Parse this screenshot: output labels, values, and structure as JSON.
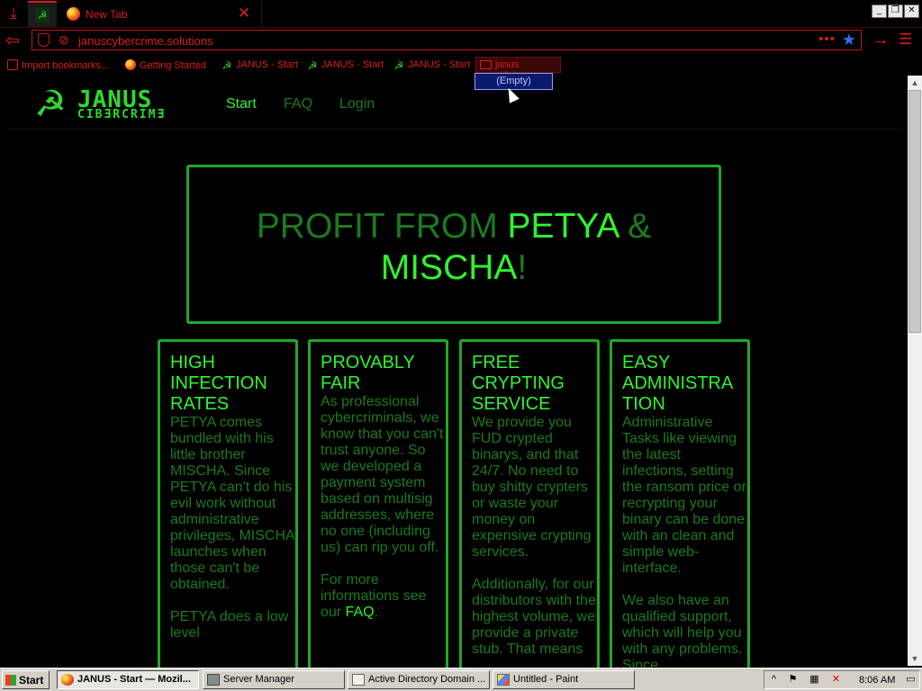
{
  "browser": {
    "tabs": [
      {
        "title": "",
        "icon": "hammer-sickle-icon",
        "active": true
      },
      {
        "title": "New Tab",
        "icon": "firefox-icon",
        "active": false
      }
    ],
    "url": "januscybercrime.solutions",
    "bookmarks": [
      {
        "label": "Import bookmarks...",
        "icon": "import-icon"
      },
      {
        "label": "Getting Started",
        "icon": "firefox-icon"
      },
      {
        "label": "JANUS - Start",
        "icon": "hammer-sickle-icon"
      },
      {
        "label": "JANUS - Start",
        "icon": "hammer-sickle-icon"
      },
      {
        "label": "JANUS - Start",
        "icon": "hammer-sickle-icon"
      }
    ],
    "bookmark_folder": "janus cybersex",
    "folder_popup": "(Empty)"
  },
  "site": {
    "logo_top": "JANUS",
    "logo_bottom": "CIBƎRCRIMƎ",
    "nav": [
      "Start",
      "FAQ",
      "Login"
    ],
    "hero": {
      "part1": "PROFIT FROM ",
      "petya": "PETYA",
      "amp": " &",
      "mischa": "MISCHA",
      "bang": "!"
    },
    "cards": [
      {
        "title": "HIGH INFECTION RATES",
        "paragraphs": [
          "PETYA comes bundled with his little brother MISCHA. Since PETYA can't do his evil work without administrative privileges, MISCHA launches when those can't be obtained.",
          "PETYA does a low level"
        ]
      },
      {
        "title": "PROVABLY FAIR",
        "paragraphs": [
          "As professional cybercriminals, we know that you can't trust anyone. So we developed a payment system based on multisig addresses, where no one (including us) can rip you off.",
          "For more informations see our"
        ],
        "link": "FAQ",
        "link_suffix": "."
      },
      {
        "title": "FREE CRYPTING SERVICE",
        "paragraphs": [
          "We provide you FUD crypted binarys, and that 24/7. No need to buy shitty crypters or waste your money on expensive crypting services.",
          "Additionally, for our distributors with the highest volume, we provide a private stub. That means"
        ]
      },
      {
        "title": "EASY ADMINISTRA TION",
        "paragraphs": [
          "Administrative Tasks like viewing the latest infections, setting the ransom price or recrypting your binary can be done with an clean and simple web-interface.",
          "We also have an qualified support, which will help you with any problems. Since"
        ]
      }
    ]
  },
  "taskbar": {
    "start": "Start",
    "tasks": [
      {
        "label": "JANUS - Start — Mozil...",
        "icon": "firefox-icon",
        "active": true
      },
      {
        "label": "Server Manager",
        "icon": "server-icon",
        "active": false
      },
      {
        "label": "Active Directory Domain ...",
        "icon": "ad-icon",
        "active": false
      },
      {
        "label": "Untitled - Paint",
        "icon": "paint-icon",
        "active": false
      }
    ],
    "clock": "8:06 AM"
  },
  "colors": {
    "accent_red": "#e01a1a",
    "neon_green": "#2ff42f",
    "dim_green": "#1a7a1f",
    "border_green": "#1fa82a"
  }
}
